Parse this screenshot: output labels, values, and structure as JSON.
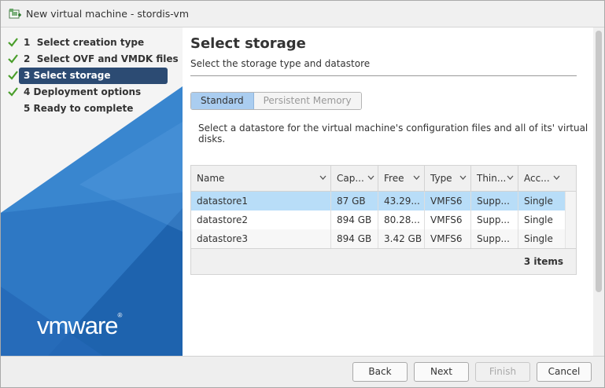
{
  "window": {
    "title": "New virtual machine - stordis-vm",
    "icon": "new-vm-icon"
  },
  "steps": [
    {
      "number": "1",
      "label": "Select creation type",
      "completed": true
    },
    {
      "number": "2",
      "label": "Select OVF and VMDK files",
      "completed": true
    },
    {
      "number": "3",
      "label": "Select storage",
      "completed": true,
      "active": true
    },
    {
      "number": "4",
      "label": "Deployment options",
      "completed": true
    },
    {
      "number": "5",
      "label": "Ready to complete",
      "completed": false
    }
  ],
  "brand": {
    "logo": "vmware",
    "mark": "®"
  },
  "page": {
    "title": "Select storage",
    "subtitle": "Select the storage type and datastore"
  },
  "storage_type": {
    "options": [
      "Standard",
      "Persistent Memory"
    ],
    "selected": "Standard"
  },
  "description": "Select a datastore for the virtual machine's configuration files and all of its' virtual disks.",
  "grid": {
    "columns": [
      "Name",
      "Cap...",
      "Free",
      "Type",
      "Thin...",
      "Acc..."
    ],
    "rows": [
      [
        "datastore1",
        "87 GB",
        "43.29...",
        "VMFS6",
        "Supp...",
        "Single"
      ],
      [
        "datastore2",
        "894 GB",
        "80.28...",
        "VMFS6",
        "Supp...",
        "Single"
      ],
      [
        "datastore3",
        "894 GB",
        "3.42 GB",
        "VMFS6",
        "Supp...",
        "Single"
      ]
    ],
    "selected_row": 0,
    "count": "3 items"
  },
  "buttons": {
    "back": "Back",
    "next": "Next",
    "finish": "Finish",
    "cancel": "Cancel"
  },
  "colors": {
    "accent_blue": "#1f6fbf",
    "active_step": "#2c4b73",
    "selected_row": "#b8ddf8",
    "check_green": "#4a9e2b"
  }
}
